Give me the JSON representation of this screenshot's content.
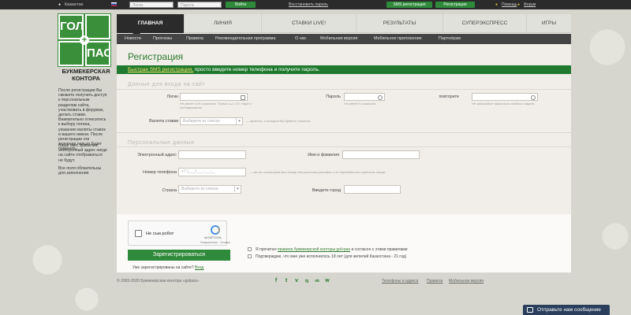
{
  "topbar": {
    "country": "Казахстан",
    "login_placeholder": "Логин",
    "password_placeholder": "Пароль",
    "login_button": "Войти",
    "restore_password": "Восстановить пароль",
    "sms_register": "SMS регистрация",
    "register": "Регистрация",
    "help": "Помощь",
    "forum": "Форум"
  },
  "logo": {
    "cells": [
      "ГОЛ",
      "+",
      "ПАС"
    ],
    "subtitle_line1": "БУКМЕКЕРСКАЯ",
    "subtitle_line2": "КОНТОРА"
  },
  "sidebar": {
    "text1": "После регистрации Вы сможете получить доступ к персональным разделам сайта, участвовать в форумах, делать ставки. Внимательно отнеситесь к выбору логина, указанию валюты ставок и вашего имени. После регистрации эти значения нельзя будет поменять.",
    "text2": "Ваши имя, фамилия, электронный адрес нигде на сайте отображаться не будут.",
    "text3": "Все поля обязательны для заполнения"
  },
  "main_nav": [
    "ГЛАВНАЯ",
    "ЛИНИЯ",
    "СТАВКИ LIVE!",
    "РЕЗУЛЬТАТЫ",
    "СУПЕРЭКСПРЕСС",
    "ИГРЫ"
  ],
  "sub_nav": [
    "Новости",
    "Прогнозы",
    "Правила",
    "Рекомендательная программа",
    "О нас",
    "Мобильная версия",
    "Мобильное приложение",
    "Партнёрам"
  ],
  "page": {
    "title": "Регистрация",
    "sms_link": "Быстрая SMS регистрация,",
    "sms_text": " просто введите номер телефона и получите пароль."
  },
  "login_section": {
    "title": "Данные для входа на сайт",
    "login_label": "Логин",
    "login_hint": "Не менее 4-ёх символов. Только a-z, 0-9, тире и подчеркивание",
    "password_label": "Пароль",
    "password_hint": "Не менее 6 символов",
    "repeat_label": "повторите",
    "repeat_hint": "Не забывайте правильно вводить пароль",
    "currency_label": "Валюта ставки",
    "currency_value": "Выберите из списка",
    "currency_hint": "— валюта, в которой Вы будете ставить"
  },
  "personal_section": {
    "title": "Персональные данные",
    "email_label": "Электронный адрес",
    "name_label": "Имя и фамилия",
    "phone_label": "Номер телефона",
    "phone_value": "+7 (___) ___-__-__",
    "phone_hint": "— мы не используем ваш номер для рассылки рекламы и не передаём его третьим лицам",
    "country_label": "Страна",
    "country_value": "Выберите из списка",
    "city_label": "Введите город"
  },
  "captcha": {
    "label": "Не съм робот",
    "brand": "reCAPTCHA",
    "terms": "Поверителност - Условия"
  },
  "agreement": {
    "prefix": "Я прочитал ",
    "rules_link": "правила букмекерской конторы gol+pas",
    "suffix": " и согласен с этими правилами",
    "age": "Подтверждаю, что мне уже исполнилось 18 лет (для жителей Казахстана - 21 год)"
  },
  "register_button": "Зарегистрироваться",
  "already_registered": "Уже зарегистрированы на сайте?",
  "login_link": "Вход",
  "footer": {
    "copyright": "© 2003-2020 Букмекерская контора «golpas»",
    "social": [
      "f",
      "t",
      "v",
      "ig",
      "ok",
      "w"
    ],
    "links": [
      "Телефоны и адреса",
      "Правила",
      "Мобильная версия"
    ]
  },
  "chat_button": "Отправьте нам сообщение"
}
